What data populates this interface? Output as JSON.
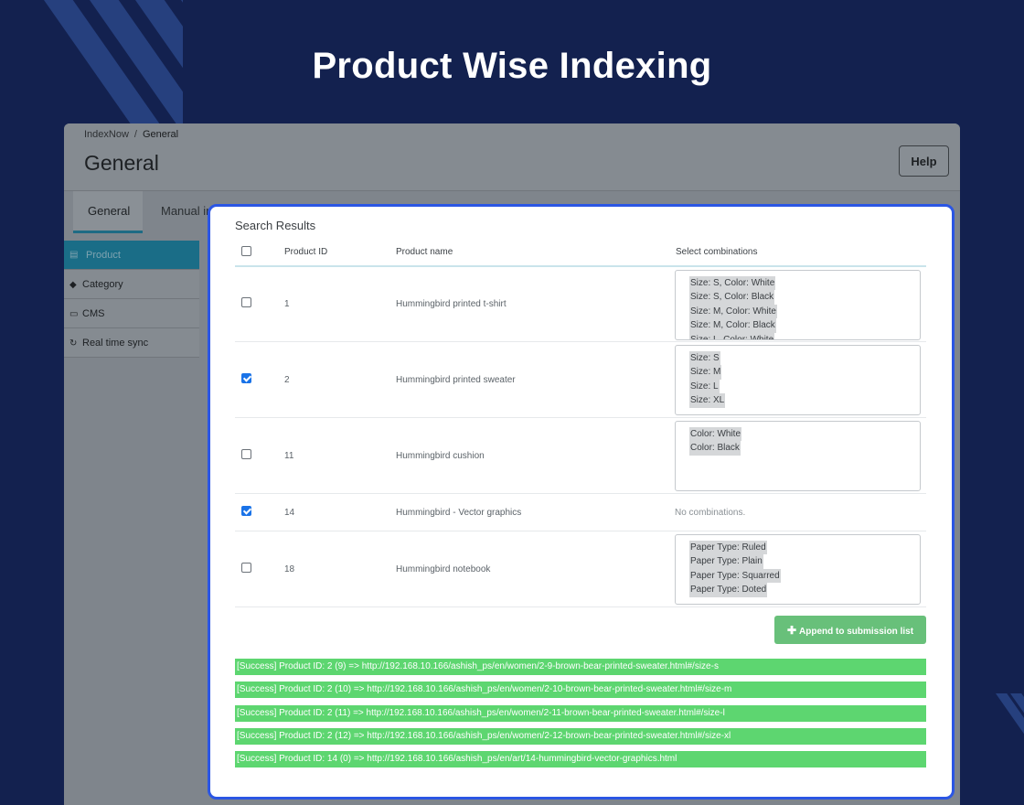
{
  "hero_title": "Product Wise Indexing",
  "admin": {
    "breadcrumb": {
      "root": "IndexNow",
      "separator": "/",
      "current": "General"
    },
    "page_title": "General",
    "help_label": "Help",
    "tabs": [
      {
        "label": "General"
      },
      {
        "label": "Manual in"
      }
    ],
    "sidebar": [
      {
        "label": "Product",
        "icon": "store-icon"
      },
      {
        "label": "Category",
        "icon": "tags-icon"
      },
      {
        "label": "CMS",
        "icon": "monitor-icon"
      },
      {
        "label": "Real time sync",
        "icon": "sync-icon"
      }
    ]
  },
  "results": {
    "title": "Search Results",
    "columns": {
      "id": "Product ID",
      "name": "Product name",
      "combos": "Select combinations"
    },
    "rows": [
      {
        "checked": false,
        "id": "1",
        "name": "Hummingbird printed t-shirt",
        "combinations": [
          "Size: S, Color: White",
          "Size: S, Color: Black",
          "Size: M, Color: White",
          "Size: M, Color: Black",
          "Size: L, Color: White"
        ]
      },
      {
        "checked": true,
        "id": "2",
        "name": "Hummingbird printed sweater",
        "combinations": [
          "Size: S",
          "Size: M",
          "Size: L",
          "Size: XL"
        ]
      },
      {
        "checked": false,
        "id": "11",
        "name": "Hummingbird cushion",
        "combinations": [
          "Color: White",
          "Color: Black"
        ]
      },
      {
        "checked": true,
        "id": "14",
        "name": "Hummingbird - Vector graphics",
        "combinations": [],
        "no_combinations": "No combinations."
      },
      {
        "checked": false,
        "id": "18",
        "name": "Hummingbird notebook",
        "combinations": [
          "Paper Type: Ruled",
          "Paper Type: Plain",
          "Paper Type: Squarred",
          "Paper Type: Doted"
        ]
      }
    ],
    "append_label": "Append to submission list",
    "logs": [
      "[Success] Product ID: 2 (9) => http://192.168.10.166/ashish_ps/en/women/2-9-brown-bear-printed-sweater.html#/size-s",
      "[Success] Product ID: 2 (10) => http://192.168.10.166/ashish_ps/en/women/2-10-brown-bear-printed-sweater.html#/size-m",
      "[Success] Product ID: 2 (11) => http://192.168.10.166/ashish_ps/en/women/2-11-brown-bear-printed-sweater.html#/size-l",
      "[Success] Product ID: 2 (12) => http://192.168.10.166/ashish_ps/en/women/2-12-brown-bear-printed-sweater.html#/size-xl",
      "[Success] Product ID: 14 (0) => http://192.168.10.166/ashish_ps/en/art/14-hummingbird-vector-graphics.html"
    ]
  },
  "colors": {
    "background": "#13214f",
    "card_border": "#2b56e4",
    "success": "#5dd670",
    "button": "#68c07a",
    "checkbox_checked": "#1a73e8"
  }
}
